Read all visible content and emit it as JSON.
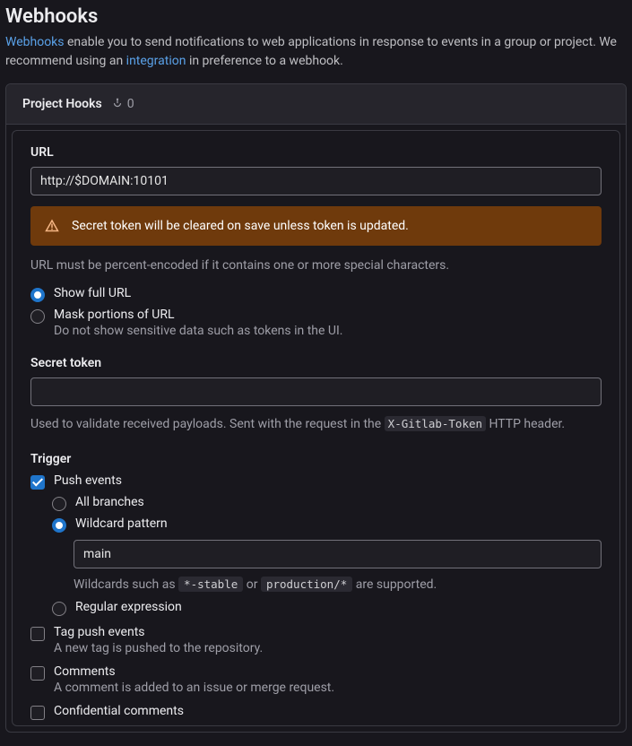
{
  "header": {
    "title": "Webhooks",
    "desc_pre_link": "Webhooks",
    "desc_part1": " enable you to send notifications to web applications in response to events in a group or project. We recommend using an ",
    "desc_link2": "integration",
    "desc_part2": " in preference to a webhook."
  },
  "panel": {
    "title": "Project Hooks",
    "count": "0"
  },
  "form": {
    "url_label": "URL",
    "url_value": "http://$DOMAIN:10101",
    "alert_text": "Secret token will be cleared on save unless token is updated.",
    "url_helper": "URL must be percent-encoded if it contains one or more special characters.",
    "url_display": {
      "show_full": "Show full URL",
      "mask": "Mask portions of URL",
      "mask_desc": "Do not show sensitive data such as tokens in the UI."
    },
    "secret_label": "Secret token",
    "secret_value": "",
    "secret_helper_pre": "Used to validate received payloads. Sent with the request in the ",
    "secret_helper_code": "X-Gitlab-Token",
    "secret_helper_post": " HTTP header.",
    "trigger_label": "Trigger",
    "triggers": {
      "push": {
        "label": "Push events"
      },
      "push_branch": {
        "all": "All branches",
        "wildcard": "Wildcard pattern",
        "wildcard_value": "main",
        "wildcard_helper_pre": "Wildcards such as ",
        "wildcard_code1": "*-stable",
        "wildcard_mid": " or ",
        "wildcard_code2": "production/*",
        "wildcard_helper_post": " are supported.",
        "regex": "Regular expression"
      },
      "tag": {
        "label": "Tag push events",
        "desc": "A new tag is pushed to the repository."
      },
      "comments": {
        "label": "Comments",
        "desc": "A comment is added to an issue or merge request."
      },
      "conf_comments": {
        "label": "Confidential comments"
      }
    }
  }
}
